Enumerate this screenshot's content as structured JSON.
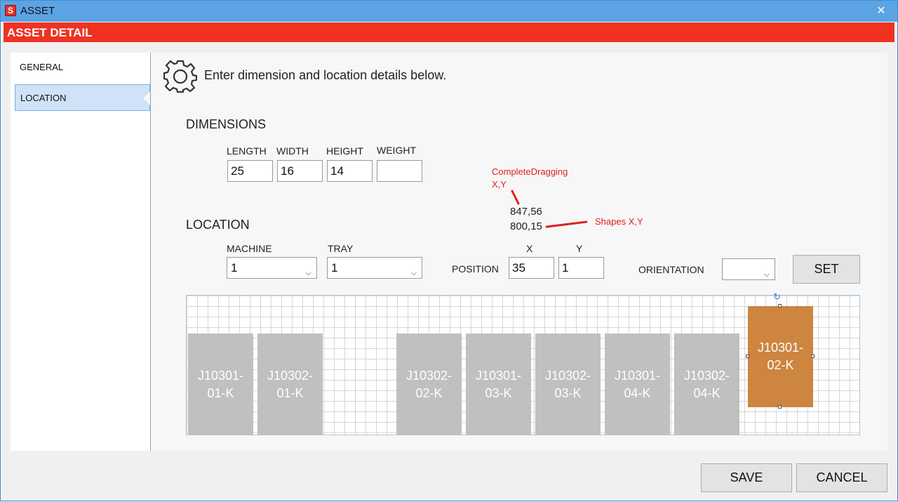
{
  "window": {
    "title": "ASSET",
    "app_icon": "S",
    "close_icon": "✕"
  },
  "header": {
    "title": "ASSET DETAIL"
  },
  "sidebar": {
    "items": [
      {
        "label": "GENERAL"
      },
      {
        "label": "LOCATION"
      }
    ]
  },
  "intro": {
    "text": "Enter dimension and location details below."
  },
  "dimensions": {
    "title": "DIMENSIONS",
    "length_label": "LENGTH",
    "length_value": "25",
    "width_label": "WIDTH",
    "width_value": "16",
    "height_label": "HEIGHT",
    "height_value": "14",
    "weight_label": "WEIGHT",
    "weight_value": ""
  },
  "location": {
    "title": "LOCATION",
    "machine_label": "MACHINE",
    "machine_value": "1",
    "tray_label": "TRAY",
    "tray_value": "1",
    "position_label": "POSITION",
    "x_label": "X",
    "x_value": "35",
    "y_label": "Y",
    "y_value": "1",
    "orientation_label": "ORIENTATION",
    "orientation_value": "",
    "set_label": "SET"
  },
  "annotations": {
    "complete_dragging_line1": "CompleteDragging",
    "complete_dragging_line2": "X,Y",
    "complete_dragging_value": "847,56",
    "shapes_value": "800,15",
    "shapes_label": "Shapes X,Y"
  },
  "shapes": [
    {
      "label": "J10301-01-K",
      "line1": "J10301-",
      "line2": "01-K"
    },
    {
      "label": "J10302-01-K",
      "line1": "J10302-",
      "line2": "01-K"
    },
    {
      "label": "J10302-02-K",
      "line1": "J10302-",
      "line2": "02-K"
    },
    {
      "label": "J10301-03-K",
      "line1": "J10301-",
      "line2": "03-K"
    },
    {
      "label": "J10302-03-K",
      "line1": "J10302-",
      "line2": "03-K"
    },
    {
      "label": "J10301-04-K",
      "line1": "J10301-",
      "line2": "04-K"
    },
    {
      "label": "J10302-04-K",
      "line1": "J10302-",
      "line2": "04-K"
    },
    {
      "label": "J10301-02-K",
      "line1": "J10301-",
      "line2": "02-K",
      "selected": true
    }
  ],
  "colors": {
    "header": "#ef3222",
    "titlebar": "#5ca3e4",
    "shape": "#c0c0c0",
    "selected_shape": "#cd853f",
    "annotation": "#e02020"
  },
  "footer": {
    "save_label": "SAVE",
    "cancel_label": "CANCEL"
  }
}
